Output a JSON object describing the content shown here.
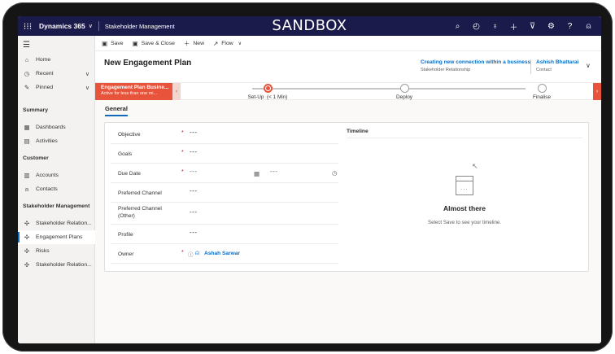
{
  "app": {
    "name": "Dynamics 365",
    "module": "Stakeholder Management",
    "environment": "SANDBOX"
  },
  "top_icons": [
    "search-icon",
    "task-icon",
    "lightbulb-icon",
    "plus-icon",
    "filter-icon",
    "gear-icon",
    "help-icon",
    "person-icon"
  ],
  "sidebar": {
    "items": [
      {
        "label": "Home",
        "icon": "home-icon"
      },
      {
        "label": "Recent",
        "icon": "clock-icon"
      },
      {
        "label": "Pinned",
        "icon": "pin-icon"
      }
    ],
    "sections": [
      {
        "title": "Summary",
        "items": [
          {
            "label": "Dashboards",
            "icon": "dashboard-icon"
          },
          {
            "label": "Activities",
            "icon": "activities-icon"
          }
        ]
      },
      {
        "title": "Customer",
        "items": [
          {
            "label": "Accounts",
            "icon": "building-icon"
          },
          {
            "label": "Contacts",
            "icon": "person-icon"
          }
        ]
      },
      {
        "title": "Stakeholder Management",
        "items": [
          {
            "label": "Stakeholder Relation...",
            "icon": "puzzle-icon"
          },
          {
            "label": "Engagement Plans",
            "icon": "puzzle-icon",
            "active": true
          },
          {
            "label": "Risks",
            "icon": "puzzle-icon"
          },
          {
            "label": "Stakeholder Relation...",
            "icon": "puzzle-icon"
          }
        ]
      }
    ]
  },
  "commands": {
    "save": "Save",
    "save_close": "Save & Close",
    "new": "New",
    "flow": "Flow"
  },
  "header": {
    "title": "New Engagement Plan",
    "related_link": "Creating new connection within a business",
    "related_type": "Stakeholder Relationship",
    "owner_name": "Ashish Bhattarai",
    "owner_type": "Contact"
  },
  "bpf": {
    "active_name": "Engagement Plan Busine...",
    "active_status": "Active for less than one mi...",
    "stages": [
      {
        "label": "Set-Up",
        "duration": "(< 1 Min)",
        "active": true
      },
      {
        "label": "Deploy",
        "active": false
      },
      {
        "label": "Finalise",
        "active": false
      }
    ]
  },
  "tabs": {
    "general": "General"
  },
  "form": {
    "placeholder": "---",
    "fields": [
      {
        "label": "Objective",
        "required": true
      },
      {
        "label": "Goals",
        "required": true
      },
      {
        "label": "Due Date",
        "required": true
      },
      {
        "label": "Preferred Channel",
        "required": false
      },
      {
        "label": "Preferred Channel (Other)",
        "required": false
      },
      {
        "label": "Profile",
        "required": false
      },
      {
        "label": "Owner",
        "required": true,
        "value": "Ashah Sarwar"
      }
    ]
  },
  "timeline": {
    "title": "Timeline",
    "empty_title": "Almost there",
    "empty_message": "Select Save to see your timeline."
  },
  "colors": {
    "topbar": "#1b1b4b",
    "accent": "#0f6cbd",
    "stage_active": "#e8543b",
    "required": "#a4262c"
  }
}
